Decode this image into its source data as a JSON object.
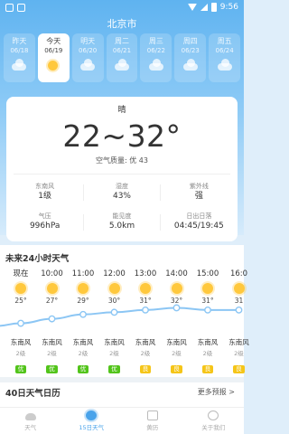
{
  "status_bar": {
    "time": "9:56"
  },
  "city": "北京市",
  "days": [
    {
      "weekday": "昨天",
      "date": "06/18",
      "icon": "cloud-icon",
      "active": false
    },
    {
      "weekday": "今天",
      "date": "06/19",
      "icon": "sun-icon",
      "active": true
    },
    {
      "weekday": "明天",
      "date": "06/20",
      "icon": "cloud-icon",
      "active": false
    },
    {
      "weekday": "周二",
      "date": "06/21",
      "icon": "cloud-icon",
      "active": false
    },
    {
      "weekday": "周三",
      "date": "06/22",
      "icon": "cloud-icon",
      "active": false
    },
    {
      "weekday": "周四",
      "date": "06/23",
      "icon": "cloud-icon",
      "active": false
    },
    {
      "weekday": "周五",
      "date": "06/24",
      "icon": "cloud-icon",
      "active": false
    }
  ],
  "today": {
    "condition": "晴",
    "temperature": "22~32°",
    "air_quality": "空气质量: 优 43",
    "metrics": [
      {
        "label": "东南风",
        "value": "1级"
      },
      {
        "label": "湿度",
        "value": "43%"
      },
      {
        "label": "紫外线",
        "value": "强"
      },
      {
        "label": "气压",
        "value": "996hPa"
      },
      {
        "label": "能见度",
        "value": "5.0km"
      },
      {
        "label": "日出日落",
        "value": "04:45/19:45"
      }
    ]
  },
  "hourly": {
    "title": "未来24小时天气",
    "items": [
      {
        "time": "现在",
        "temp": "25°",
        "temp_value": 25,
        "wind": "东南风",
        "level": "2级",
        "aqi": "优",
        "aqi_color": "#52c41a"
      },
      {
        "time": "10:00",
        "temp": "27°",
        "temp_value": 27,
        "wind": "东南风",
        "level": "2级",
        "aqi": "优",
        "aqi_color": "#52c41a"
      },
      {
        "time": "11:00",
        "temp": "29°",
        "temp_value": 29,
        "wind": "东南风",
        "level": "2级",
        "aqi": "优",
        "aqi_color": "#52c41a"
      },
      {
        "time": "12:00",
        "temp": "30°",
        "temp_value": 30,
        "wind": "东南风",
        "level": "2级",
        "aqi": "优",
        "aqi_color": "#52c41a"
      },
      {
        "time": "13:00",
        "temp": "31°",
        "temp_value": 31,
        "wind": "东南风",
        "level": "2级",
        "aqi": "良",
        "aqi_color": "#f5c518"
      },
      {
        "time": "14:00",
        "temp": "32°",
        "temp_value": 32,
        "wind": "东南风",
        "level": "2级",
        "aqi": "良",
        "aqi_color": "#f5c518"
      },
      {
        "time": "15:00",
        "temp": "31°",
        "temp_value": 31,
        "wind": "东南风",
        "level": "2级",
        "aqi": "良",
        "aqi_color": "#f5c518"
      },
      {
        "time": "16:0",
        "temp": "31",
        "temp_value": 31,
        "wind": "东南风",
        "level": "2级",
        "aqi": "良",
        "aqi_color": "#f5c518"
      }
    ]
  },
  "forty_day": {
    "title": "40日天气日历",
    "more": "更多预报 >"
  },
  "nav": [
    {
      "label": "天气",
      "icon": "cloud-icon",
      "active": false
    },
    {
      "label": "15日天气",
      "icon": "sun-icon",
      "active": true
    },
    {
      "label": "黄历",
      "icon": "calendar-icon",
      "active": false
    },
    {
      "label": "关于我们",
      "icon": "info-icon",
      "active": false
    }
  ]
}
